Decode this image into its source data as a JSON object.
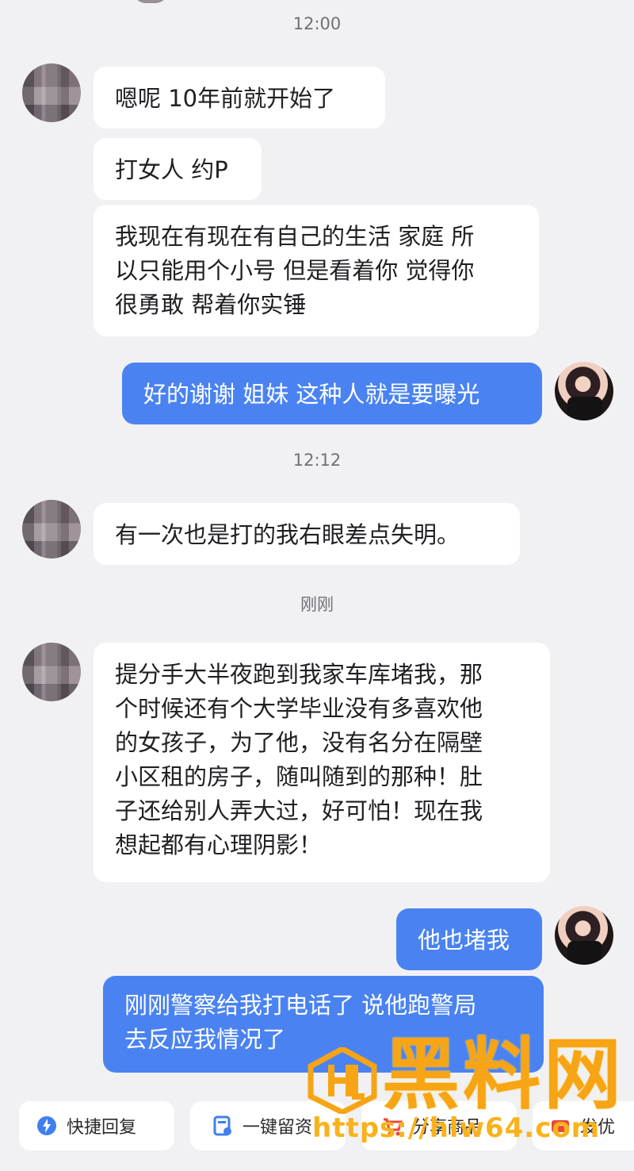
{
  "timestamps": {
    "t1": "12:00",
    "t2": "12:12",
    "t3": "刚刚"
  },
  "messages": [
    {
      "side": "in",
      "text": "嗯呢 10年前就开始了"
    },
    {
      "side": "in",
      "text": "打女人 约P"
    },
    {
      "side": "in",
      "lines": [
        "我现在有现在有自己的生活 家庭 所",
        "以只能用个小号 但是看着你 觉得你",
        "很勇敢 帮着你实锤"
      ]
    },
    {
      "side": "out",
      "text": "好的谢谢 姐妹 这种人就是要曝光"
    },
    {
      "side": "in",
      "text": "有一次也是打的我右眼差点失明。"
    },
    {
      "side": "in",
      "lines": [
        "提分手大半夜跑到我家车库堵我，那",
        "个时候还有个大学毕业没有多喜欢他",
        "的女孩子，为了他，没有名分在隔壁",
        "小区租的房子，随叫随到的那种！肚",
        "子还给别人弄大过，好可怕！现在我",
        "想起都有心理阴影！"
      ]
    },
    {
      "side": "out",
      "text": "他也堵我"
    },
    {
      "side": "out",
      "lines": [
        "刚刚警察给我打电话了 说他跑警局",
        "去反应我情况了"
      ]
    }
  ],
  "bottom_bar": {
    "quick_reply": "快捷回复",
    "one_click": "一键留资",
    "share": "分享商品",
    "send": "发优"
  },
  "watermark": {
    "title": "黑料网",
    "url": "https://hlw64.com"
  },
  "icons": {
    "quick_reply": "bolt-icon",
    "one_click": "form-icon",
    "share": "cart-icon",
    "watermark": "hl-logo-icon"
  },
  "colors": {
    "background": "#f1f1f4",
    "outgoing_bubble": "#4a83f1",
    "incoming_bubble": "#ffffff",
    "watermark": "#f7a415"
  }
}
